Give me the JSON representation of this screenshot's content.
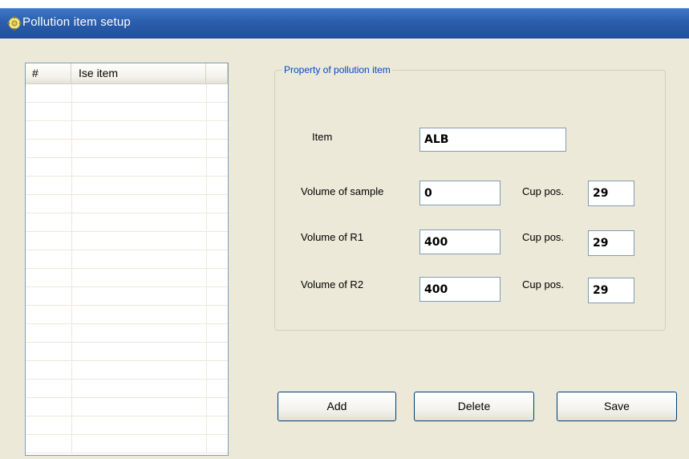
{
  "window": {
    "title": "Pollution item setup",
    "title_icon": "lightbulb-gear-icon"
  },
  "list": {
    "columns": [
      "#",
      "Ise item",
      ""
    ],
    "rows": []
  },
  "property_group": {
    "legend": "Property of pollution item",
    "item_label": "Item",
    "item_value": "ALB",
    "sample_label": "Volume of sample",
    "sample_value": "0",
    "sample_cup_label": "Cup pos.",
    "sample_cup_value": "29",
    "r1_label": "Volume of R1",
    "r1_value": "400",
    "r1_cup_label": "Cup pos.",
    "r1_cup_value": "29",
    "r2_label": "Volume of R2",
    "r2_value": "400",
    "r2_cup_label": "Cup pos.",
    "r2_cup_value": "29"
  },
  "buttons": {
    "add": "Add",
    "delete": "Delete",
    "save": "Save"
  },
  "colors": {
    "titlebar": "#2b5fae",
    "window_bg": "#ece9d8",
    "legend_text": "#0046d5",
    "field_border": "#7f9db9"
  }
}
